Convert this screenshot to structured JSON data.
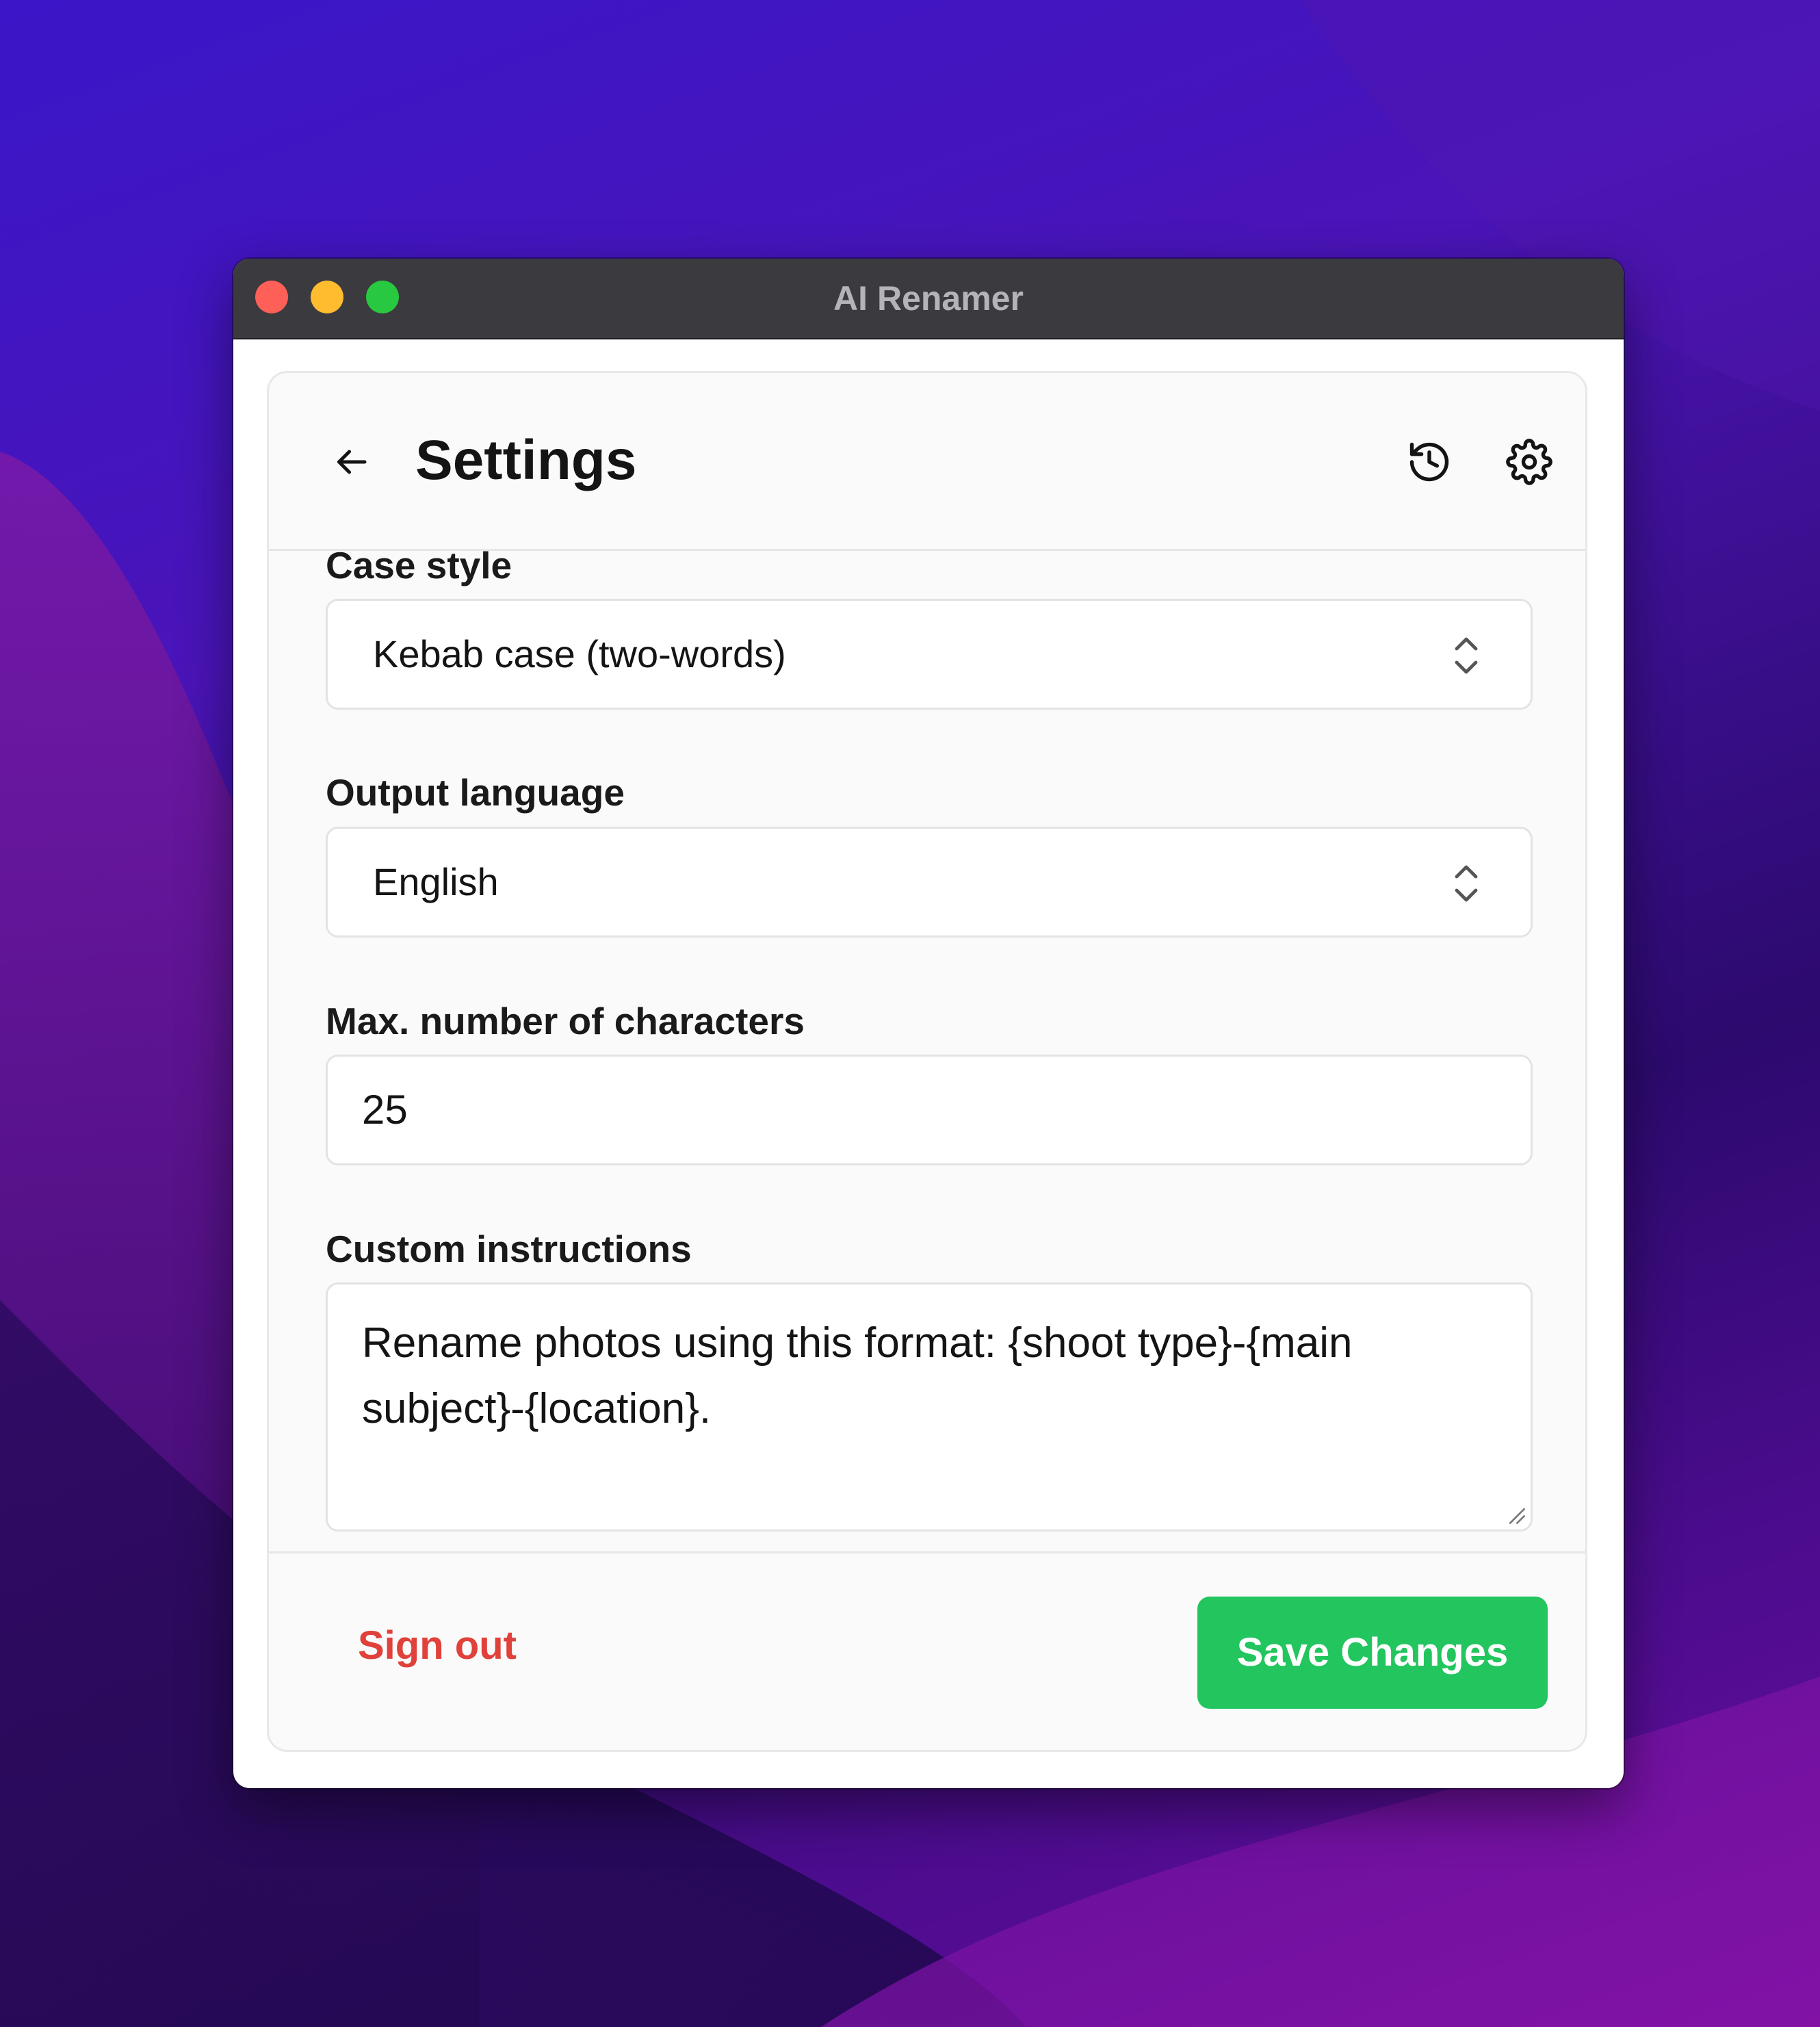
{
  "window": {
    "title": "AI Renamer"
  },
  "header": {
    "title": "Settings",
    "icons": [
      "arrow-left-icon",
      "history-icon",
      "gear-icon"
    ]
  },
  "fields": {
    "case_style": {
      "label": "Case style",
      "value": "Kebab case (two-words)"
    },
    "output_language": {
      "label": "Output language",
      "value": "English"
    },
    "max_chars": {
      "label": "Max. number of characters",
      "value": "25"
    },
    "custom_instructions": {
      "label": "Custom instructions",
      "value": "Rename photos using this format: {shoot type}-{main subject}-{location}."
    }
  },
  "footer": {
    "sign_out_label": "Sign out",
    "save_label": "Save Changes"
  },
  "colors": {
    "accent": "#22c55e",
    "danger": "#e0413a",
    "titlebar": "#3a3a3f"
  }
}
